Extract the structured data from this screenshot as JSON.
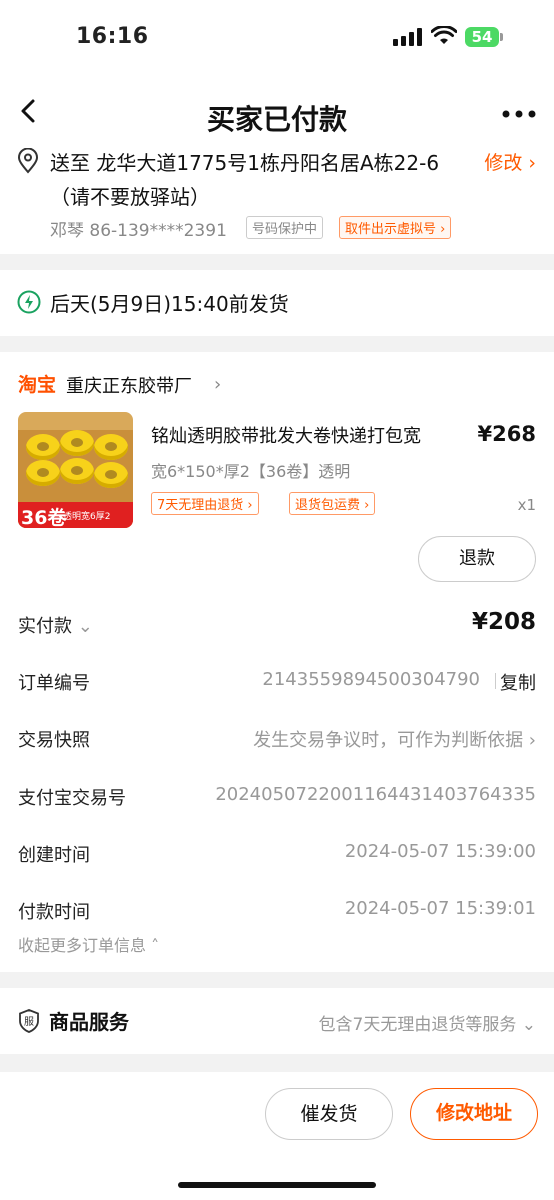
{
  "status": {
    "time": "16:16",
    "battery": "54"
  },
  "nav": {
    "title": "买家已付款"
  },
  "address": {
    "text": "送至 龙华大道1775号1栋丹阳名居A栋22-6（请不要放驿站）",
    "edit_label": "修改",
    "contact": "邓琴 86-139****2391",
    "privacy_tag": "号码保护中",
    "virtual_tag": "取件出示虚拟号"
  },
  "shipping": {
    "text": "后天(5月9日)15:40前发货"
  },
  "shop": {
    "logo": "淘宝",
    "name": "重庆正东胶带厂"
  },
  "product": {
    "title": "铭灿透明胶带批发大卷快递打包宽",
    "price": "¥268",
    "sku": "宽6*150*厚2【36卷】透明",
    "tag1": "7天无理由退货",
    "tag2": "退货包运费",
    "qty": "x1",
    "badge_count": "36卷",
    "badge_text": "透明宽6厚2",
    "refund_label": "退款"
  },
  "order_info": {
    "paid_label": "实付款",
    "paid_value": "¥208",
    "order_no_label": "订单编号",
    "order_no": "2143559894500304790",
    "copy_label": "复制",
    "snapshot_label": "交易快照",
    "snapshot_value": "发生交易争议时，可作为判断依据",
    "alipay_label": "支付宝交易号",
    "alipay_no": "2024050722001164431403764335",
    "created_label": "创建时间",
    "created_value": "2024-05-07 15:39:00",
    "paid_time_label": "付款时间",
    "paid_time_value": "2024-05-07 15:39:01",
    "collapse_label": "收起更多订单信息"
  },
  "services": {
    "title": "商品服务",
    "desc": "包含7天无理由退货等服务"
  },
  "actions": {
    "urge_label": "催发货",
    "change_label": "修改地址"
  },
  "colors": {
    "accent": "#ff5a00",
    "battery": "#4cd964"
  }
}
